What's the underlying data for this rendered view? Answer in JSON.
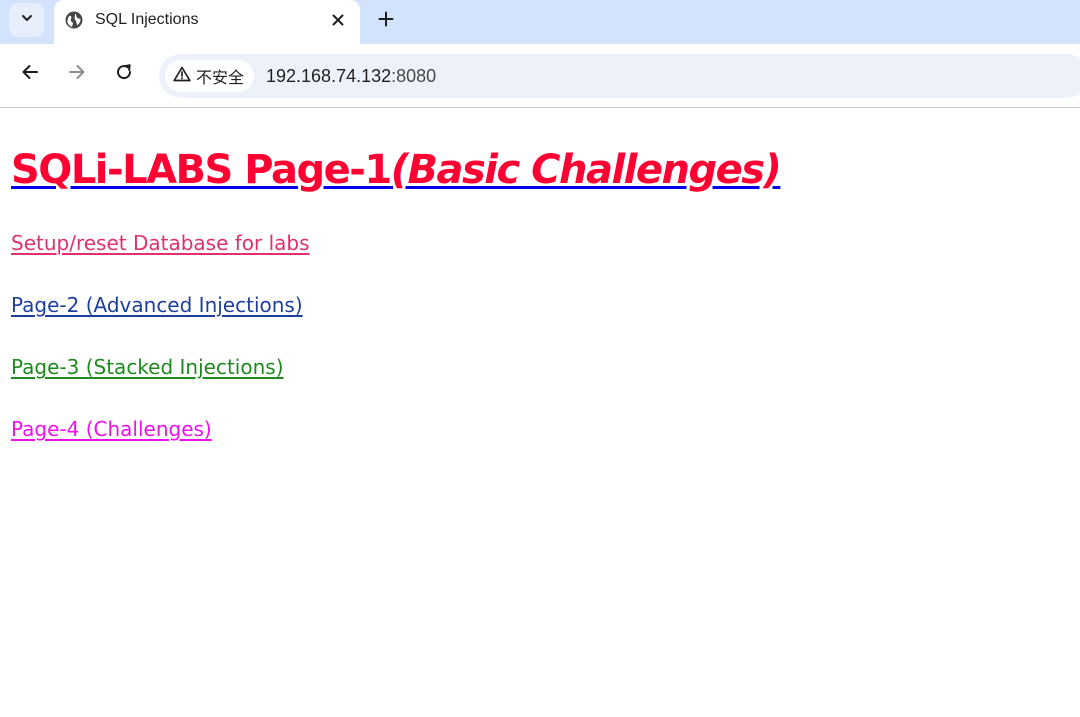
{
  "browser": {
    "tab": {
      "title": "SQL Injections",
      "favicon": "globe-icon"
    },
    "address_bar": {
      "security_label": "不安全",
      "security_icon": "warning-triangle-icon",
      "host": "192.168.74.132",
      "port": ":8080"
    },
    "icons": {
      "tab_search": "chevron-down-icon",
      "close": "close-icon",
      "new_tab": "plus-icon",
      "back": "back-arrow-icon",
      "forward": "forward-arrow-icon",
      "reload": "reload-icon"
    },
    "colors": {
      "tabstrip_bg": "#d3e3fd",
      "omnibox_bg": "#edf2fa"
    }
  },
  "page": {
    "heading": {
      "main": "SQLi-LABS Page-1",
      "sub": "(Basic Challenges)",
      "color": "#ff0033",
      "underline_color": "#0000ee"
    },
    "links": [
      {
        "label": "Setup/reset Database for labs",
        "color": "#e0306e"
      },
      {
        "label": "Page-2 (Advanced Injections)",
        "color": "#1f3f9e"
      },
      {
        "label": "Page-3 (Stacked Injections)",
        "color": "#1f8a1f"
      },
      {
        "label": "Page-4 (Challenges)",
        "color": "#ee11ee"
      }
    ]
  }
}
